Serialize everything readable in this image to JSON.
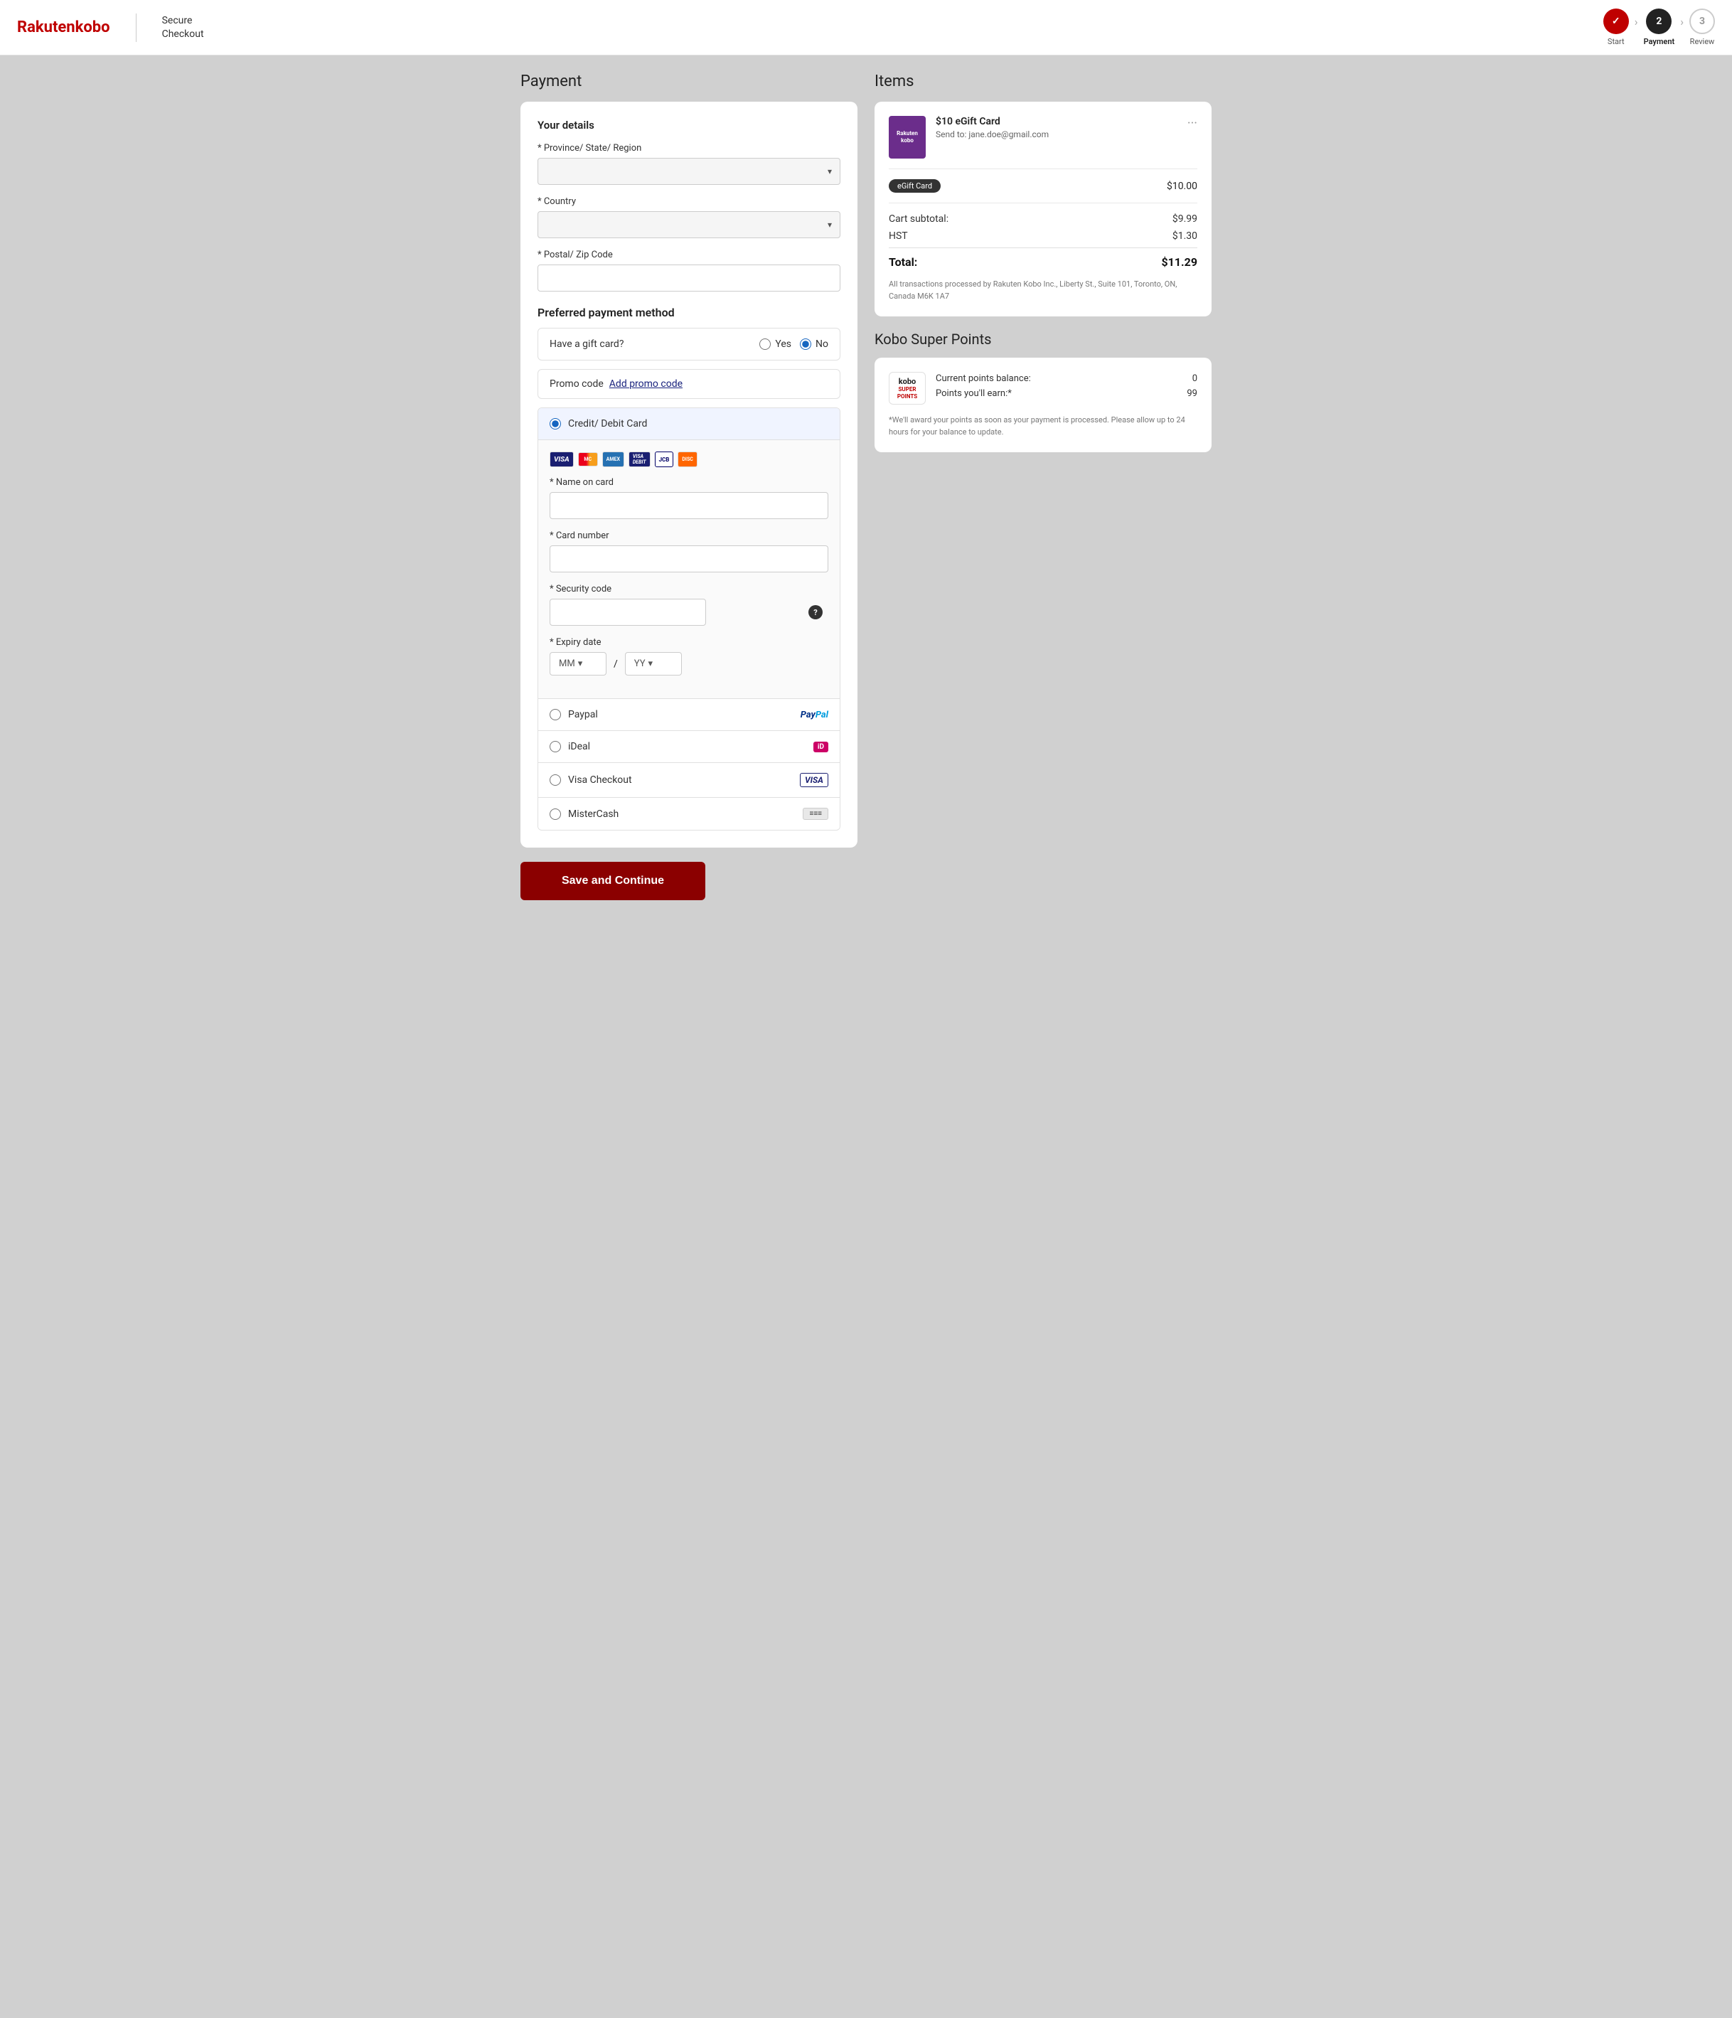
{
  "header": {
    "logo_rakuten": "Rakuten",
    "logo_kobo": "kobo",
    "secure_checkout_line1": "Secure",
    "secure_checkout_line2": "Checkout"
  },
  "stepper": {
    "steps": [
      {
        "id": "start",
        "label": "Start",
        "number": "✓",
        "state": "done"
      },
      {
        "id": "payment",
        "label": "Payment",
        "number": "2",
        "state": "active"
      },
      {
        "id": "review",
        "label": "Review",
        "number": "3",
        "state": "inactive"
      }
    ]
  },
  "payment": {
    "page_title": "Payment",
    "your_details_title": "Your details",
    "province_label": "* Province/ State/ Region",
    "country_label": "* Country",
    "postal_label": "* Postal/ Zip Code",
    "preferred_payment_title": "Preferred payment method",
    "gift_card_label": "Have a gift card?",
    "gift_card_yes": "Yes",
    "gift_card_no": "No",
    "promo_label": "Promo code",
    "promo_link": "Add promo code",
    "credit_card_label": "Credit/ Debit Card",
    "name_on_card_label": "* Name on card",
    "card_number_label": "* Card number",
    "security_code_label": "* Security code",
    "expiry_label": "* Expiry date",
    "expiry_mm": "MM",
    "expiry_yy": "YY",
    "paypal_label": "Paypal",
    "ideal_label": "iDeal",
    "visa_checkout_label": "Visa Checkout",
    "mistercash_label": "MisterCash",
    "save_button": "Save and Continue"
  },
  "items": {
    "section_title": "Items",
    "product": {
      "name": "$10 eGift Card",
      "send_to": "Send to: jane.doe@gmail.com",
      "badge": "eGift Card",
      "price": "$10.00",
      "thumb_line1": "Rakuten",
      "thumb_line2": "kobo"
    },
    "cart_subtotal_label": "Cart subtotal:",
    "cart_subtotal_value": "$9.99",
    "hst_label": "HST",
    "hst_value": "$1.30",
    "total_label": "Total:",
    "total_value": "$11.29",
    "company_note": "All transactions processed by Rakuten Kobo Inc., Liberty St., Suite 101, Toronto, ON, Canada M6K 1A7"
  },
  "super_points": {
    "section_title": "Kobo Super Points",
    "current_balance_label": "Current points balance:",
    "current_balance_value": "0",
    "earn_label": "Points you'll earn:*",
    "earn_value": "99",
    "note": "*We'll award your points as soon as your payment is processed. Please allow up to 24 hours for your balance to update."
  }
}
